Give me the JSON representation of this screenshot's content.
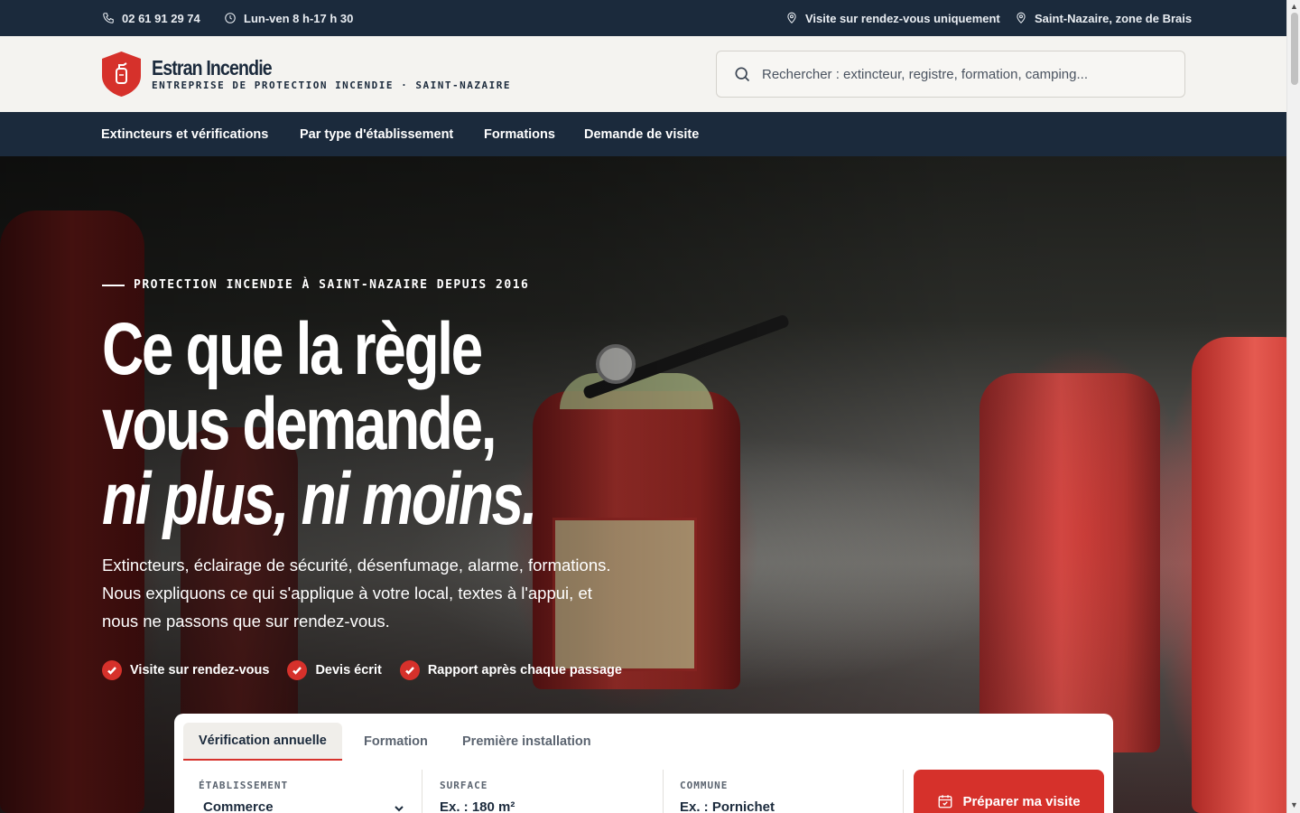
{
  "topbar": {
    "phone": "02 61 91 29 74",
    "hours": "Lun-ven 8 h-17 h 30",
    "visit_note": "Visite sur rendez-vous uniquement",
    "location": "Saint-Nazaire, zone de Brais"
  },
  "header": {
    "brand_name": "Estran Incendie",
    "brand_tagline": "ENTREPRISE DE PROTECTION INCENDIE · SAINT-NAZAIRE",
    "search_placeholder": "Rechercher : extincteur, registre, formation, camping..."
  },
  "nav": {
    "items": [
      "Extincteurs et vérifications",
      "Par type d'établissement",
      "Formations",
      "Demande de visite"
    ]
  },
  "hero": {
    "eyebrow": "PROTECTION INCENDIE À SAINT-NAZAIRE DEPUIS 2016",
    "headline_line1": "Ce que la règle",
    "headline_line2": "vous demande,",
    "headline_line3": "ni plus, ni moins.",
    "lead": "Extincteurs, éclairage de sécurité, désenfumage, alarme, formations. Nous expliquons ce qui s'applique à votre local, textes à l'appui, et nous ne passons que sur rendez-vous.",
    "checks": [
      "Visite sur rendez-vous",
      "Devis écrit",
      "Rapport après chaque passage"
    ]
  },
  "booking": {
    "tabs": [
      "Vérification annuelle",
      "Formation",
      "Première installation"
    ],
    "active_tab": "Vérification annuelle",
    "establishment_label": "ÉTABLISSEMENT",
    "establishment_value": "Commerce",
    "surface_label": "SURFACE",
    "surface_placeholder": "Ex. : 180 m²",
    "commune_label": "COMMUNE",
    "commune_placeholder": "Ex. : Pornichet",
    "cta_label": "Préparer ma visite"
  },
  "colors": {
    "navy": "#1b2a3c",
    "accent_red": "#d6312b",
    "background": "#f4f3f0"
  },
  "icons": {
    "phone": "phone-icon",
    "clock": "clock-icon",
    "pin": "map-pin-icon",
    "search": "search-icon",
    "check": "check-icon",
    "calendar": "calendar-icon",
    "chevron": "chevron-down-icon",
    "logo": "shield-extinguisher-icon"
  }
}
